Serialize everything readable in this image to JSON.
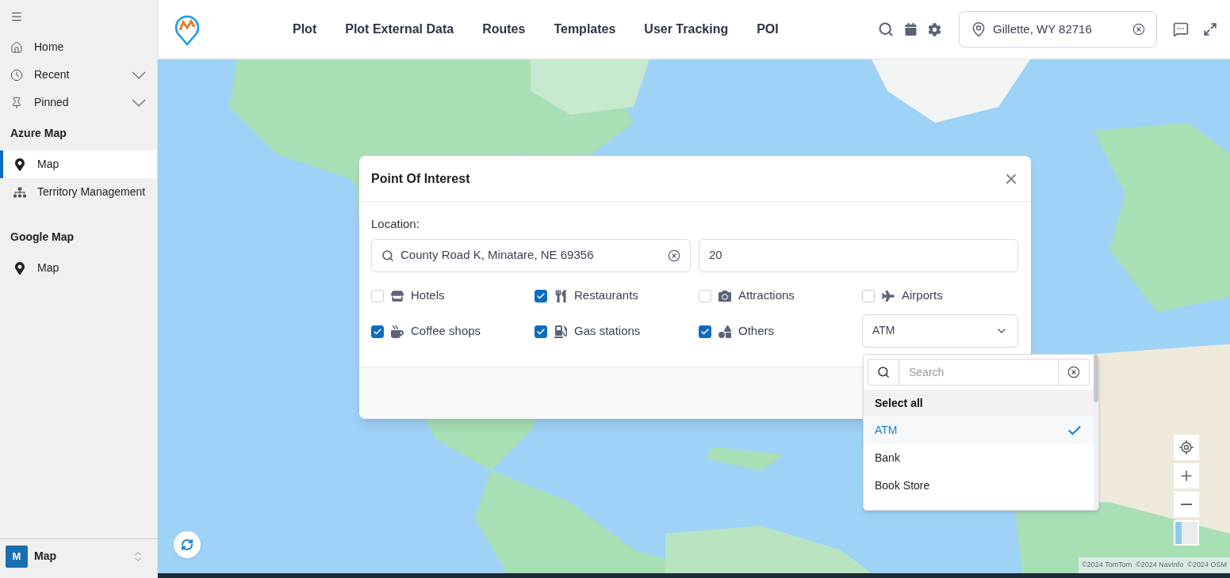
{
  "sidebar": {
    "menu_items": [
      {
        "label": "Home",
        "kind": "home",
        "expandable": false
      },
      {
        "label": "Recent",
        "kind": "clock",
        "expandable": true
      },
      {
        "label": "Pinned",
        "kind": "pin",
        "expandable": true
      }
    ],
    "sections": [
      {
        "title": "Azure Map",
        "items": [
          {
            "label": "Map",
            "kind": "marker",
            "selected": true
          },
          {
            "label": "Territory Management",
            "kind": "network",
            "selected": false
          }
        ]
      },
      {
        "title": "Google Map",
        "items": [
          {
            "label": "Map",
            "kind": "marker",
            "selected": false
          }
        ]
      }
    ],
    "footer": {
      "badge": "M",
      "label": "Map"
    }
  },
  "header": {
    "nav": [
      "Plot",
      "Plot External Data",
      "Routes",
      "Templates",
      "User Tracking",
      "POI"
    ],
    "location": "Gillette, WY 82716"
  },
  "modal": {
    "title": "Point Of Interest",
    "location_label": "Location:",
    "location_value": "County Road K, Minatare, NE 69356",
    "radius": "20",
    "categories": [
      {
        "label": "Hotels",
        "kind": "hotel",
        "checked": false
      },
      {
        "label": "Restaurants",
        "kind": "restaurant",
        "checked": true
      },
      {
        "label": "Attractions",
        "kind": "camera",
        "checked": false
      },
      {
        "label": "Airports",
        "kind": "plane",
        "checked": false
      },
      {
        "label": "Coffee shops",
        "kind": "coffee",
        "checked": true
      },
      {
        "label": "Gas stations",
        "kind": "gas",
        "checked": true
      },
      {
        "label": "Others",
        "kind": "shapes",
        "checked": true
      }
    ],
    "select_value": "ATM",
    "dropdown": {
      "placeholder": "Search",
      "select_all": "Select all",
      "options": [
        {
          "label": "ATM",
          "selected": true
        },
        {
          "label": "Bank",
          "selected": false
        },
        {
          "label": "Book Store",
          "selected": false
        }
      ]
    }
  },
  "attribution": "©2024 TomTom  ©2024 NavInfo  ©2024 OSM"
}
